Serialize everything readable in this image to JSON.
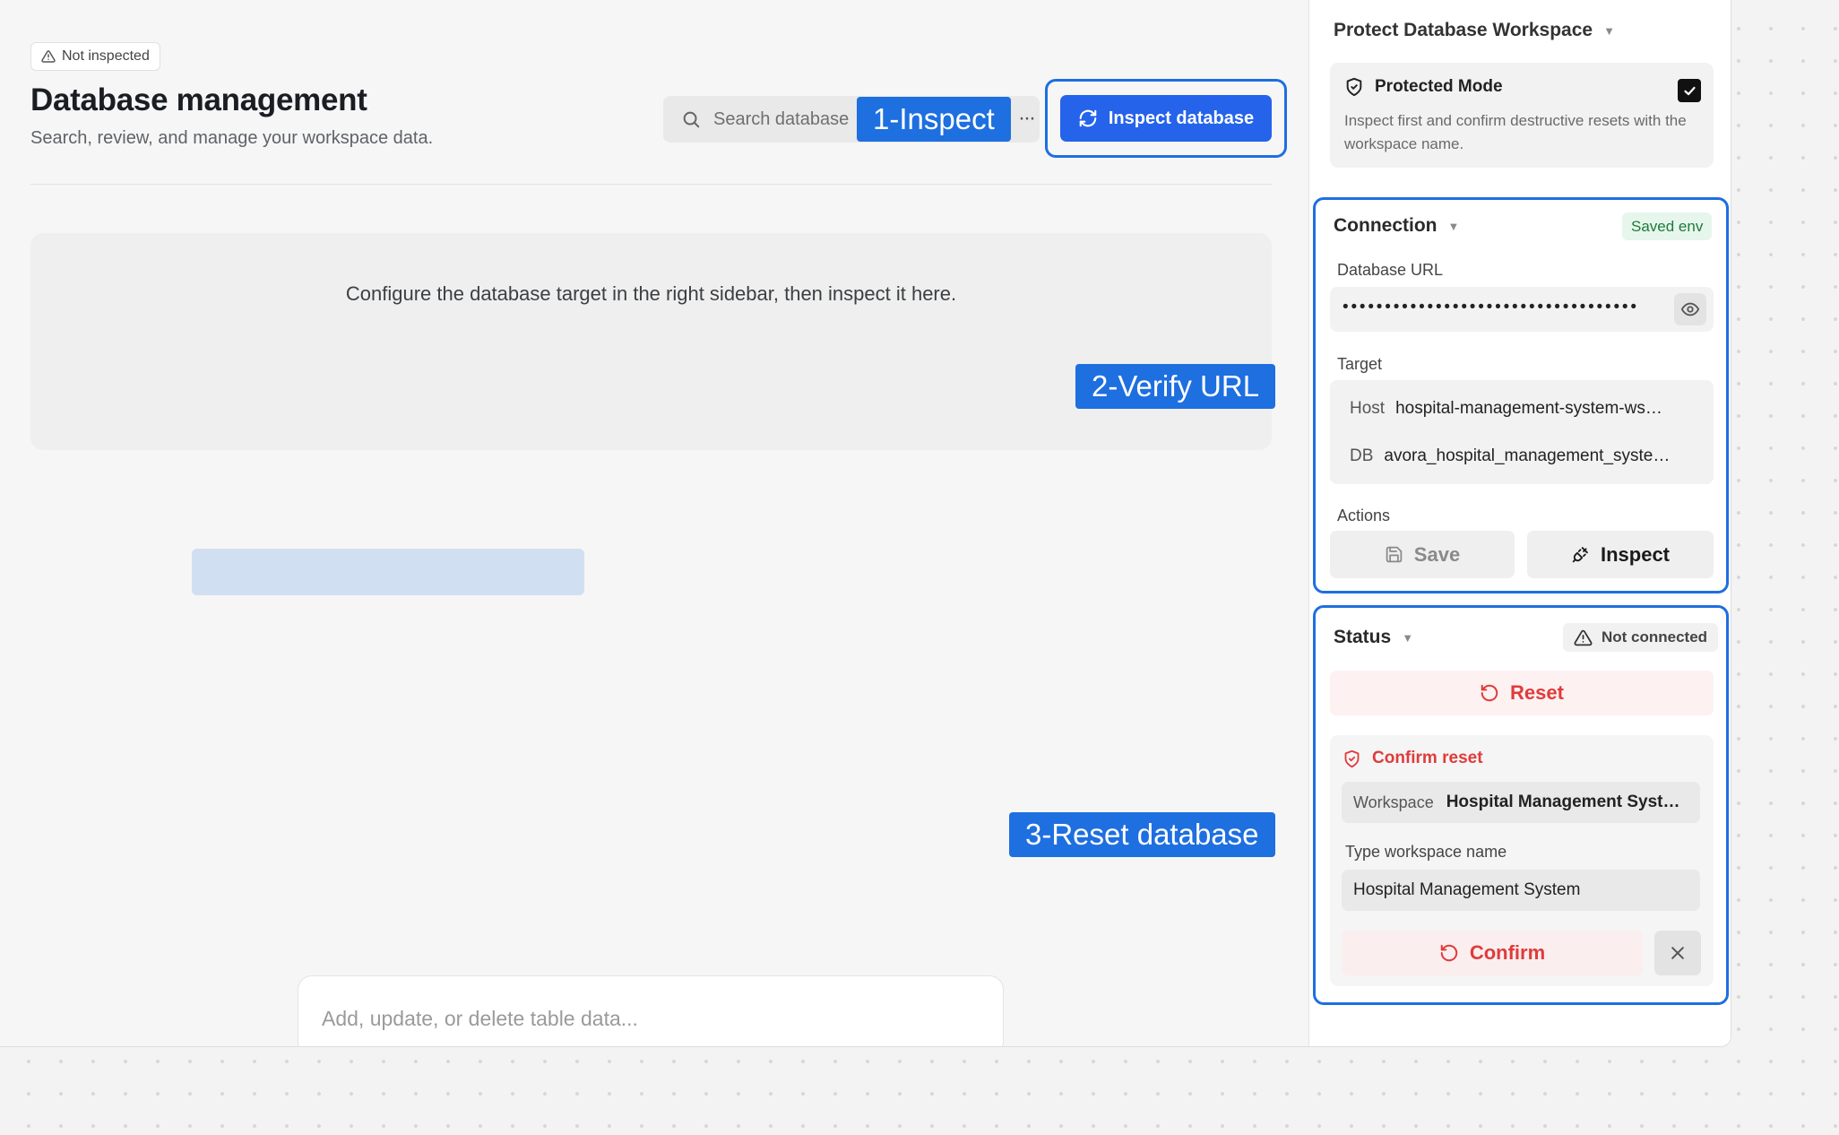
{
  "header": {
    "status_chip": "Not inspected",
    "title": "Database management",
    "subtitle": "Search, review, and manage your workspace data.",
    "search_placeholder": "Search database",
    "more_label": "···",
    "inspect_button": "Inspect database"
  },
  "main": {
    "empty_message": "Configure the database target in the right sidebar, then inspect it here.",
    "chat_placeholder": "Add, update, or delete table data..."
  },
  "callouts": {
    "step1": "1-Inspect",
    "step2": "2-Verify URL",
    "step3": "3-Reset database"
  },
  "sidebar": {
    "title": "Protect Database Workspace",
    "protected": {
      "label": "Protected Mode",
      "checked": true,
      "description": "Inspect first and confirm destructive resets with the workspace name."
    },
    "connection": {
      "title": "Connection",
      "badge": "Saved env",
      "url_label": "Database URL",
      "url_masked": "•••••••••••••••••••••••••••••••••••",
      "target_label": "Target",
      "host_key": "Host",
      "host_value": "hospital-management-system-ws…",
      "db_key": "DB",
      "db_value": "avora_hospital_management_syste…",
      "actions_label": "Actions",
      "save_button": "Save",
      "inspect_button": "Inspect"
    },
    "status": {
      "title": "Status",
      "badge": "Not connected",
      "reset_button": "Reset",
      "confirm_title": "Confirm reset",
      "workspace_key": "Workspace",
      "workspace_value": "Hospital Management Syst…",
      "type_label": "Type workspace name",
      "type_value": "Hospital Management System",
      "confirm_button": "Confirm"
    }
  },
  "colors": {
    "accent": "#2563eb",
    "callout": "#1e6fe0",
    "danger": "#e03b3b",
    "success": "#1e7a3d"
  }
}
